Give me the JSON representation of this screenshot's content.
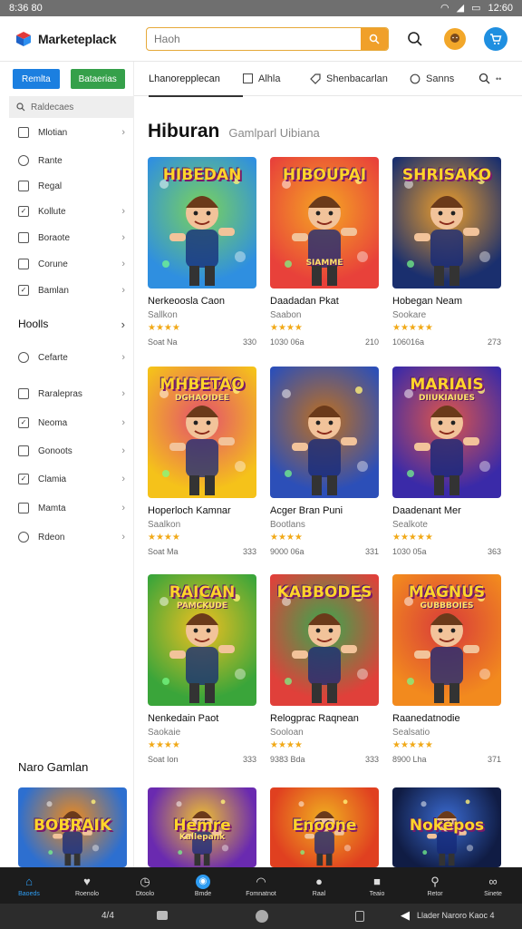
{
  "status_bar": {
    "time": "8:36 80",
    "right_time": "12:60"
  },
  "header": {
    "app_name": "Marketeplack",
    "search_placeholder": "Haoh"
  },
  "sidebar": {
    "btn_primary": "Remlta",
    "btn_secondary": "Bataerias",
    "search_label": "Raldecaes",
    "items": [
      {
        "label": "Mlotian",
        "type": "box"
      },
      {
        "label": "Rante",
        "type": "round"
      },
      {
        "label": "Regal",
        "type": "box"
      },
      {
        "label": "Kollute",
        "type": "check"
      },
      {
        "label": "Boraote",
        "type": "box"
      },
      {
        "label": "Corune",
        "type": "box"
      },
      {
        "label": "Bamlan",
        "type": "check"
      },
      {
        "label": "Hoolls",
        "type": "section"
      },
      {
        "label": "Cefarte",
        "type": "round"
      },
      {
        "label": "Raralepras",
        "type": "box"
      },
      {
        "label": "Neoma",
        "type": "check"
      },
      {
        "label": "Gonoots",
        "type": "box"
      },
      {
        "label": "Clamia",
        "type": "check"
      },
      {
        "label": "Mamta",
        "type": "box"
      },
      {
        "label": "Rdeon",
        "type": "round"
      }
    ]
  },
  "tabs": [
    {
      "label": "Lhanorepplecan",
      "icon": "none"
    },
    {
      "label": "Alhla",
      "icon": "square-icon"
    },
    {
      "label": "Shenbacarlan",
      "icon": "tag-icon"
    },
    {
      "label": "Sanns",
      "icon": "chat-icon"
    }
  ],
  "main": {
    "title": "Hiburan",
    "subtitle": "Gamlparl Uibiana",
    "section_more": "Naro Gamlan"
  },
  "games": [
    {
      "title": "Nerkeoosla Caon",
      "sub": "Sallkon",
      "stars": "★★★★",
      "meta_left": "Soat Na",
      "meta_right": "330",
      "art": "HIBEDAN",
      "art2": ""
    },
    {
      "title": "Daadadan Pkat",
      "sub": "Saabon",
      "stars": "★★★★",
      "meta_left": "1030 06a",
      "meta_right": "210",
      "art": "HIBOUPAI",
      "art2": "SIAMME"
    },
    {
      "title": "Hobegan Neam",
      "sub": "Sookare",
      "stars": "★★★★★",
      "meta_left": "106016a",
      "meta_right": "273",
      "art": "SHRISAKO",
      "art2": ""
    },
    {
      "title": "Hoperloch Kamnar",
      "sub": "Saalkon",
      "stars": "★★★★",
      "meta_left": "Soat Ma",
      "meta_right": "333",
      "art": "MHBETAO",
      "art2": "DGHAOIDEE"
    },
    {
      "title": "Acger Bran Puni",
      "sub": "Bootlans",
      "stars": "★★★★",
      "meta_left": "9000 06a",
      "meta_right": "331",
      "art": "",
      "art2": ""
    },
    {
      "title": "Daadenant Mer",
      "sub": "Sealkote",
      "stars": "★★★★★",
      "meta_left": "1030 05a",
      "meta_right": "363",
      "art": "MARIAIS",
      "art2": "DIIUKIAIUES"
    },
    {
      "title": "Nenkedain Paot",
      "sub": "Saokaie",
      "stars": "★★★★",
      "meta_left": "Soat Ion",
      "meta_right": "333",
      "art": "RAICAN",
      "art2": "PAMCKUDE"
    },
    {
      "title": "Relogprac Raqnean",
      "sub": "Sooloan",
      "stars": "★★★★",
      "meta_left": "9383 Bda",
      "meta_right": "333",
      "art": "KABBODES",
      "art2": ""
    },
    {
      "title": "Raanedatnodie",
      "sub": "Sealsatio",
      "stars": "★★★★★",
      "meta_left": "8900 Lha",
      "meta_right": "371",
      "art": "MAGNUS",
      "art2": "GUBBBOIES"
    },
    {
      "title": "",
      "sub": "",
      "stars": "",
      "meta_left": "",
      "meta_right": "",
      "art": "BOBRAIK",
      "art2": ""
    },
    {
      "title": "",
      "sub": "",
      "stars": "",
      "meta_left": "",
      "meta_right": "",
      "art": "Hemre",
      "art2": "Kallepank"
    },
    {
      "title": "",
      "sub": "",
      "stars": "",
      "meta_left": "",
      "meta_right": "",
      "art": "Enoone",
      "art2": ""
    },
    {
      "title": "",
      "sub": "",
      "stars": "",
      "meta_left": "",
      "meta_right": "",
      "art": "Nokepos",
      "art2": ""
    }
  ],
  "bottom_nav": [
    {
      "label": "Baoeds",
      "icon": "home-icon"
    },
    {
      "label": "Roenolo",
      "icon": "heart-icon"
    },
    {
      "label": "Dtoolo",
      "icon": "clock-icon"
    },
    {
      "label": "Bmde",
      "icon": "games-icon"
    },
    {
      "label": "Fomnatnot",
      "icon": "chat-icon"
    },
    {
      "label": "Raal",
      "icon": "globe-icon"
    },
    {
      "label": "Teaio",
      "icon": "box-icon"
    },
    {
      "label": "Retor",
      "icon": "search-icon"
    },
    {
      "label": "Sinete",
      "icon": "more-icon"
    }
  ],
  "system_nav": {
    "left": "4/4",
    "right": "Llader Naroro Kaoc 4"
  },
  "colors": {
    "accent": "#1b7fe0",
    "orange": "#f0a02a",
    "green": "#35a04a",
    "star": "#f1a918"
  }
}
